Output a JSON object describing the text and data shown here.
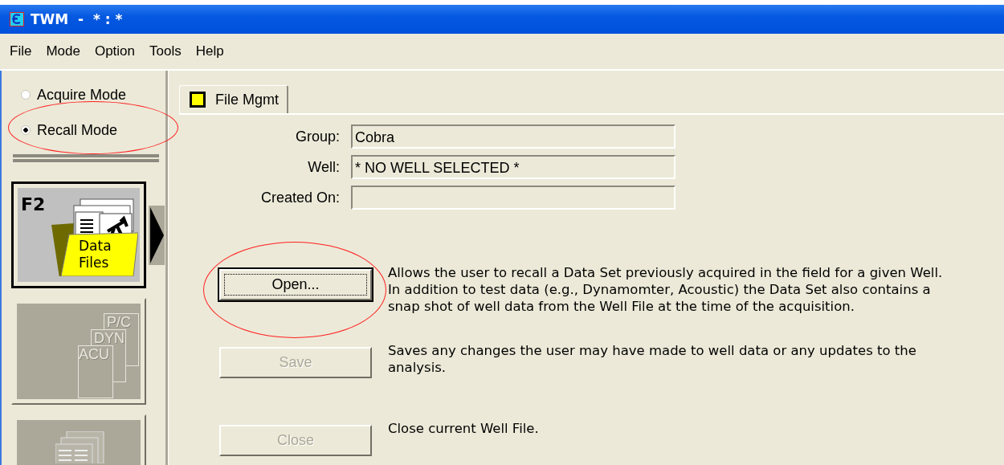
{
  "window": {
    "title": "TWM  -  * : *"
  },
  "menu": [
    {
      "label": "File"
    },
    {
      "label": "Mode"
    },
    {
      "label": "Option"
    },
    {
      "label": "Tools"
    },
    {
      "label": "Help"
    }
  ],
  "mode_options": [
    {
      "label": "Acquire Mode",
      "selected": false,
      "circled": false
    },
    {
      "label": "Recall Mode",
      "selected": true,
      "circled": true
    }
  ],
  "nav_buttons": [
    {
      "kind": "data-files",
      "key": "F2",
      "label": "Data Files",
      "disabled": false,
      "selected": true
    },
    {
      "kind": "reports",
      "labels": [
        "P/C",
        "DYN",
        "ACU"
      ],
      "disabled": true,
      "selected": false
    },
    {
      "kind": "tables",
      "disabled": true,
      "selected": false
    }
  ],
  "tabs": [
    {
      "label": "File Mgmt",
      "selected": true
    }
  ],
  "fields": [
    {
      "label": "Group:",
      "value": "Cobra"
    },
    {
      "label": "Well:",
      "value": "* NO WELL SELECTED *"
    },
    {
      "label": "Created On:"
    }
  ],
  "actions": [
    {
      "label": "Open...",
      "disabled": false,
      "focused": true,
      "circled": true,
      "description": "Allows the user to recall a Data Set previously acquired in the field for a given Well.  In addition to test data (e.g.,  Dynamomter, Acoustic) the Data Set also contains a snap shot of well data from the Well File at the time of the acquisition."
    },
    {
      "label": "Save",
      "disabled": true,
      "focused": false,
      "circled": false,
      "description": "Saves any changes the user may have made to well data or any updates to the analysis."
    },
    {
      "label": "Close",
      "disabled": true,
      "focused": false,
      "circled": false,
      "description": "Close current Well File."
    }
  ]
}
